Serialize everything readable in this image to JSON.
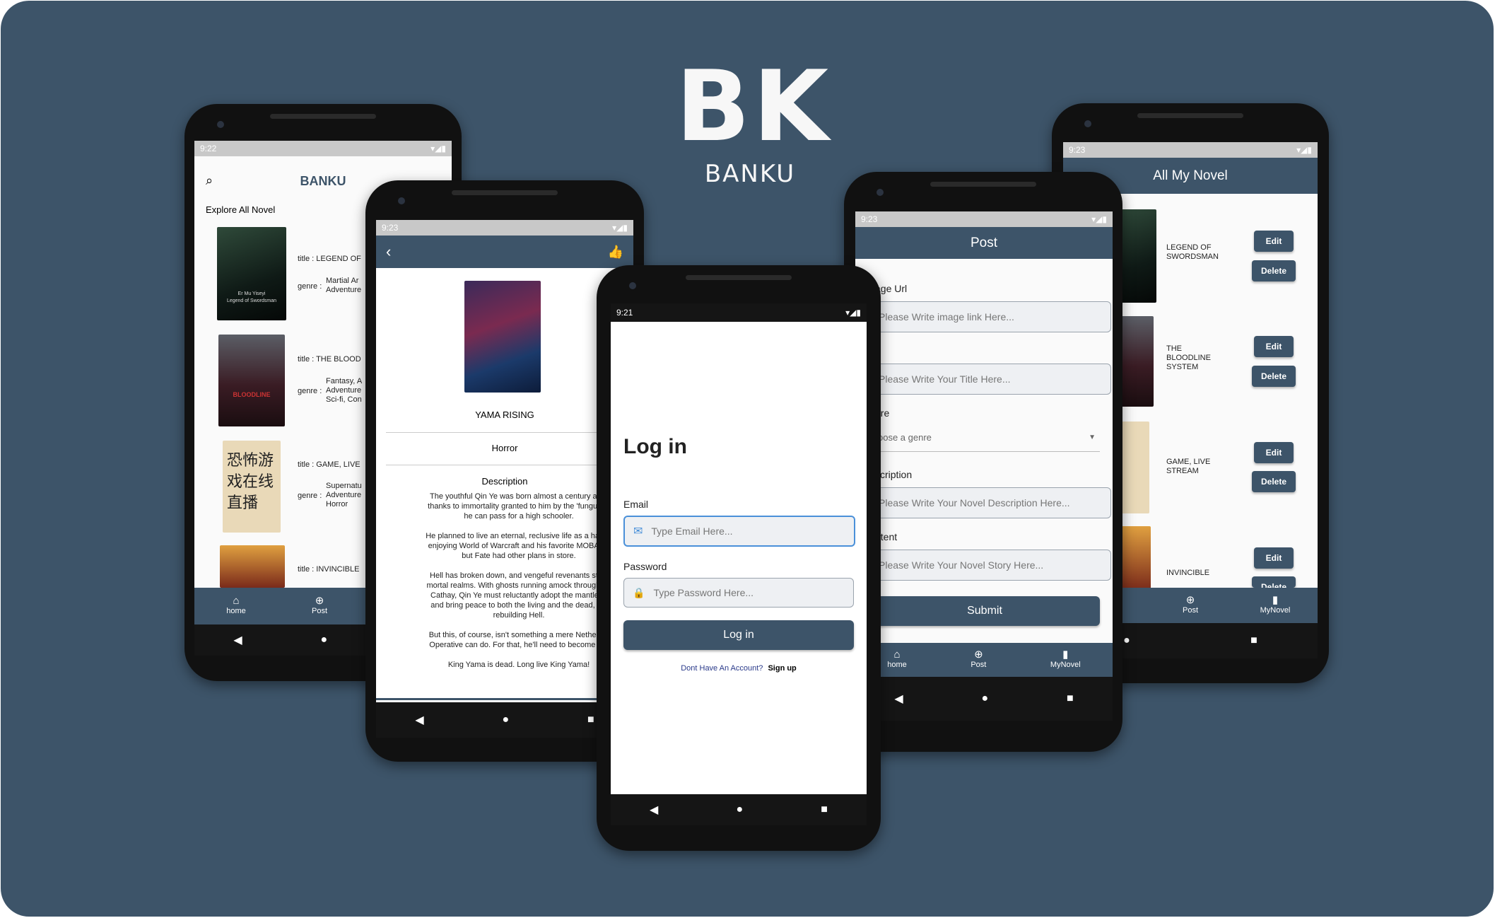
{
  "logo": {
    "mark": "BK",
    "name": "BANKU"
  },
  "status_times": {
    "p1": "9:22",
    "p2": "9:23",
    "p3": "9:21",
    "p4": "9:23",
    "p5": "9:23"
  },
  "home": {
    "title": "BANKU",
    "section": "Explore All Novel",
    "novels": [
      {
        "title": "title : LEGEND OF",
        "genre_label": "genre :",
        "genre_1": "Martial Ar",
        "genre_2": "Adventure",
        "genre_3": ""
      },
      {
        "title": "title : THE BLOOD",
        "genre_label": "genre :",
        "genre_1": "Fantasy, A",
        "genre_2": "Adventure",
        "genre_3": "Sci-fi, Con"
      },
      {
        "title": "title : GAME, LIVE",
        "genre_label": "genre :",
        "genre_1": "Supernatu",
        "genre_2": "Adventure",
        "genre_3": "Horror"
      },
      {
        "title": "title : INVINCIBLE"
      }
    ],
    "cover_texts": {
      "c1_l1": "Er Mu Yiseyi",
      "c1_l2": "Legend of Swordsman",
      "c2": "BLOODLINE",
      "c3_l1": "恐怖游",
      "c3_l2": "戏在线",
      "c3_l3": "直播"
    },
    "nav": {
      "home": "home",
      "post": "Post"
    }
  },
  "detail": {
    "title": "YAMA RISING",
    "genre": "Horror",
    "desc_label": "Description",
    "p1_l1": "The youthful Qin Ye was born almost a century ago,",
    "p1_l2": "thanks to immortality granted to him by the 'fungus of",
    "p1_l3": "he can pass for a high schooler.",
    "p2_l1": "He planned to live an eternal, reclusive life as a happy",
    "p2_l2": "enjoying World of Warcraft and his favorite MOBA ga",
    "p2_l3": "but Fate had other plans in store.",
    "p3_l1": "Hell has broken down, and vengeful revenants stalk",
    "p3_l2": "mortal realms. With ghosts running amock throughout",
    "p3_l3": "Cathay, Qin Ye must reluctantly adopt the mantle of",
    "p3_l4": "and bring peace to both the living and the dead, wh",
    "p3_l5": "rebuilding Hell.",
    "p4_l1": "But this, of course, isn't something a mere Netherwo",
    "p4_l2": "Operative can do. For that, he'll need to become mo",
    "p5": "King Yama is dead. Long live King Yama!"
  },
  "login": {
    "heading": "Log in",
    "email_label": "Email",
    "email_placeholder": "Type Email Here...",
    "password_label": "Password",
    "password_placeholder": "Type Password Here...",
    "button": "Log in",
    "no_account": "Dont Have An Account?",
    "signup": "Sign up"
  },
  "post": {
    "title": "Post",
    "image_label": "age Url",
    "image_placeholder": "Please Write image link Here...",
    "title_label": "e",
    "title_placeholder": "Please Write Your Title Here...",
    "genre_label": "nre",
    "genre_placeholder": "oose a genre",
    "desc_label": "scription",
    "desc_placeholder": "Please Write Your Novel Description Here...",
    "content_label": "ntent",
    "content_placeholder": "Please Write Your Novel Story Here...",
    "submit": "Submit",
    "nav": {
      "home": "home",
      "post": "Post",
      "mynovel": "MyNovel"
    }
  },
  "mynovel": {
    "title": "All My Novel",
    "items": [
      {
        "l1": "LEGEND OF",
        "l2": "SWORDSMAN",
        "l3": ""
      },
      {
        "l1": "THE",
        "l2": "BLOODLINE",
        "l3": "SYSTEM"
      },
      {
        "l1": "GAME, LIVE",
        "l2": "STREAM",
        "l3": ""
      },
      {
        "l1": "INVINCIBLE",
        "l2": "",
        "l3": ""
      }
    ],
    "edit": "Edit",
    "delete": "Delete",
    "delete_cut": "Delete",
    "nav": {
      "post": "Post",
      "mynovel": "MyNovel"
    }
  }
}
